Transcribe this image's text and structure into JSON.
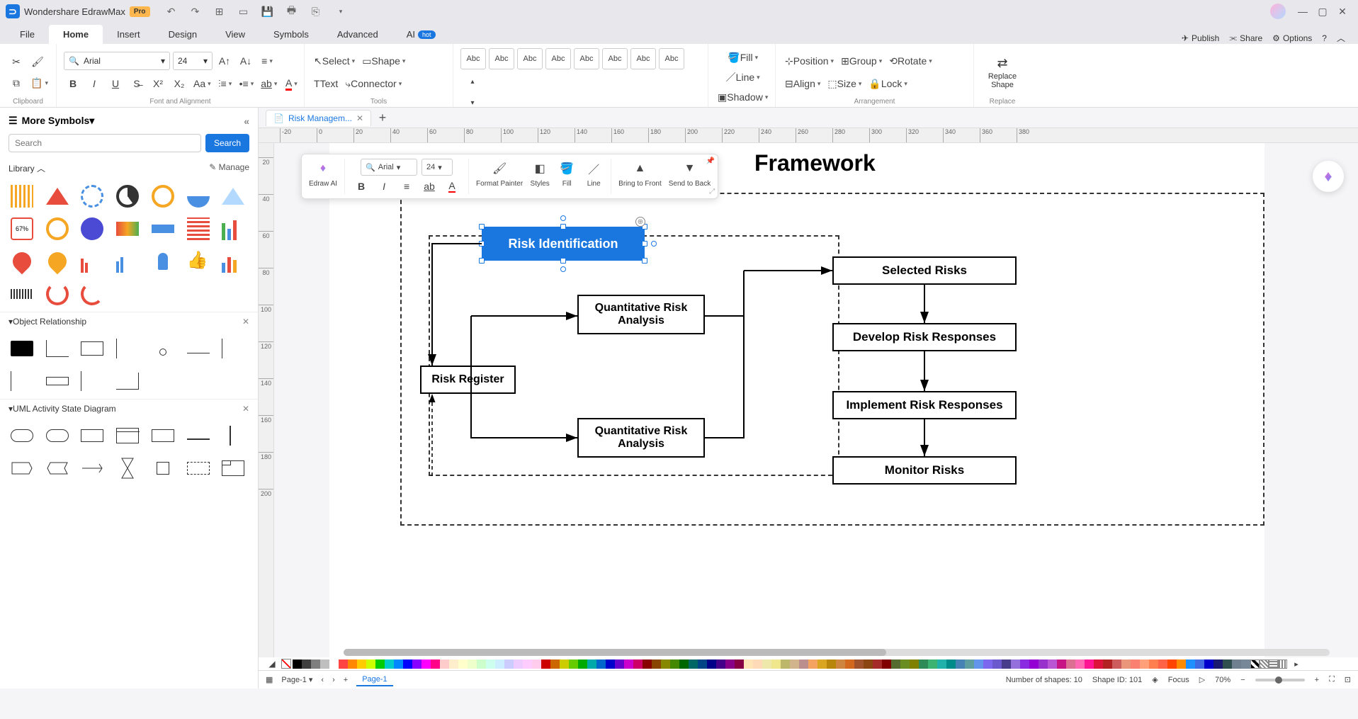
{
  "app": {
    "name": "Wondershare EdrawMax",
    "badge": "Pro"
  },
  "menu": {
    "tabs": [
      "File",
      "Home",
      "Insert",
      "Design",
      "View",
      "Symbols",
      "Advanced"
    ],
    "ai_label": "AI",
    "ai_badge": "hot",
    "active": "Home",
    "right": {
      "publish": "Publish",
      "share": "Share",
      "options": "Options"
    }
  },
  "ribbon": {
    "clipboard_label": "Clipboard",
    "font_label": "Font and Alignment",
    "font_name": "Arial",
    "font_size": "24",
    "tools_label": "Tools",
    "select_label": "Select",
    "shape_label": "Shape",
    "text_label": "Text",
    "connector_label": "Connector",
    "styles_label": "Styles",
    "style_sample": "Abc",
    "fill_label": "Fill",
    "line_label": "Line",
    "shadow_label": "Shadow",
    "arrangement_label": "Arrangement",
    "position_label": "Position",
    "group_label": "Group",
    "rotate_label": "Rotate",
    "align_label": "Align",
    "size_label": "Size",
    "lock_label": "Lock",
    "replace_label": "Replace",
    "replace_shape": "Replace Shape"
  },
  "leftpanel": {
    "title": "More Symbols",
    "search_placeholder": "Search",
    "search_btn": "Search",
    "library_label": "Library",
    "manage_label": "Manage",
    "section1": "Object Relationship",
    "section2": "UML Activity State Diagram"
  },
  "doc": {
    "tab_name": "Risk Managem...",
    "ruler_ticks": [
      "-20",
      "0",
      "20",
      "40",
      "60",
      "80",
      "100",
      "120",
      "140",
      "160",
      "180",
      "200",
      "220",
      "240",
      "260",
      "280",
      "300",
      "320",
      "340",
      "360",
      "380"
    ],
    "vruler_ticks": [
      "20",
      "40",
      "60",
      "80",
      "100",
      "120",
      "140",
      "160",
      "180",
      "200"
    ]
  },
  "diagram": {
    "title_visible": "Framework",
    "shapes": {
      "risk_id": "Risk Identification",
      "risk_register": "Risk Register",
      "qra1": "Quantitative Risk Analysis",
      "qra2": "Quantitative Risk Analysis",
      "selected_risks": "Selected Risks",
      "develop": "Develop Risk Responses",
      "implement": "Implement Risk Responses",
      "monitor": "Monitor Risks"
    }
  },
  "minitool": {
    "edraw_ai": "Edraw AI",
    "font_name": "Arial",
    "font_size": "24",
    "format_painter": "Format Painter",
    "styles": "Styles",
    "fill": "Fill",
    "line": "Line",
    "bring_front": "Bring to Front",
    "send_back": "Send to Back"
  },
  "status": {
    "page_dropdown": "Page-1",
    "page_tab": "Page-1",
    "shapes_count": "Number of shapes: 10",
    "shape_id": "Shape ID: 101",
    "focus": "Focus",
    "zoom": "70%"
  }
}
